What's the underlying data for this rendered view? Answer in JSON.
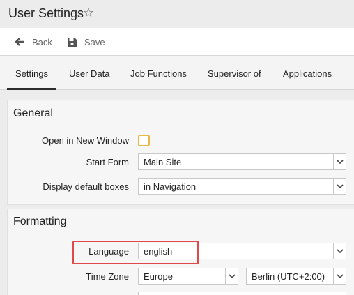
{
  "header": {
    "title": "User Settings",
    "favorite_icon": "star-outline-icon"
  },
  "toolbar": {
    "back_label": "Back",
    "save_label": "Save"
  },
  "tabs": [
    {
      "label": "Settings",
      "active": true
    },
    {
      "label": "User Data",
      "active": false
    },
    {
      "label": "Job Functions",
      "active": false
    },
    {
      "label": "Supervisor of",
      "active": false
    },
    {
      "label": "Applications",
      "active": false
    }
  ],
  "general": {
    "title": "General",
    "open_new_window_label": "Open in New Window",
    "open_new_window_checked": false,
    "start_form_label": "Start Form",
    "start_form_value": "Main Site",
    "default_boxes_label": "Display default boxes",
    "default_boxes_value": "in Navigation"
  },
  "formatting": {
    "title": "Formatting",
    "language_label": "Language",
    "language_value": "english",
    "timezone_label": "Time Zone",
    "timezone_region_value": "Europe",
    "timezone_city_value": "Berlin (UTC+2:00)"
  },
  "colors": {
    "checkbox_border": "#e9b84a",
    "highlight_border": "#e0484a",
    "active_tab_underline": "#2b2b2b"
  }
}
